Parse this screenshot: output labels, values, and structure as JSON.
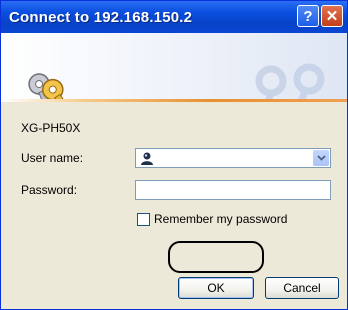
{
  "window": {
    "title": "Connect to 192.168.150.2",
    "help_glyph": "?",
    "close_glyph": "✕"
  },
  "server_name": "XG-PH50X",
  "form": {
    "username_label": "User name:",
    "password_label": "Password:",
    "username_value": "",
    "password_value": "",
    "remember_label": "Remember my password",
    "remember_checked": false
  },
  "buttons": {
    "ok_label": "OK",
    "cancel_label": "Cancel"
  },
  "icons": {
    "banner": "keys-icon",
    "user": "user-icon",
    "dropdown": "chevron-down-icon"
  },
  "colors": {
    "titlebar": "#0a4fe0",
    "dialog_bg": "#ece9d8",
    "accent_line": "#e79033"
  }
}
